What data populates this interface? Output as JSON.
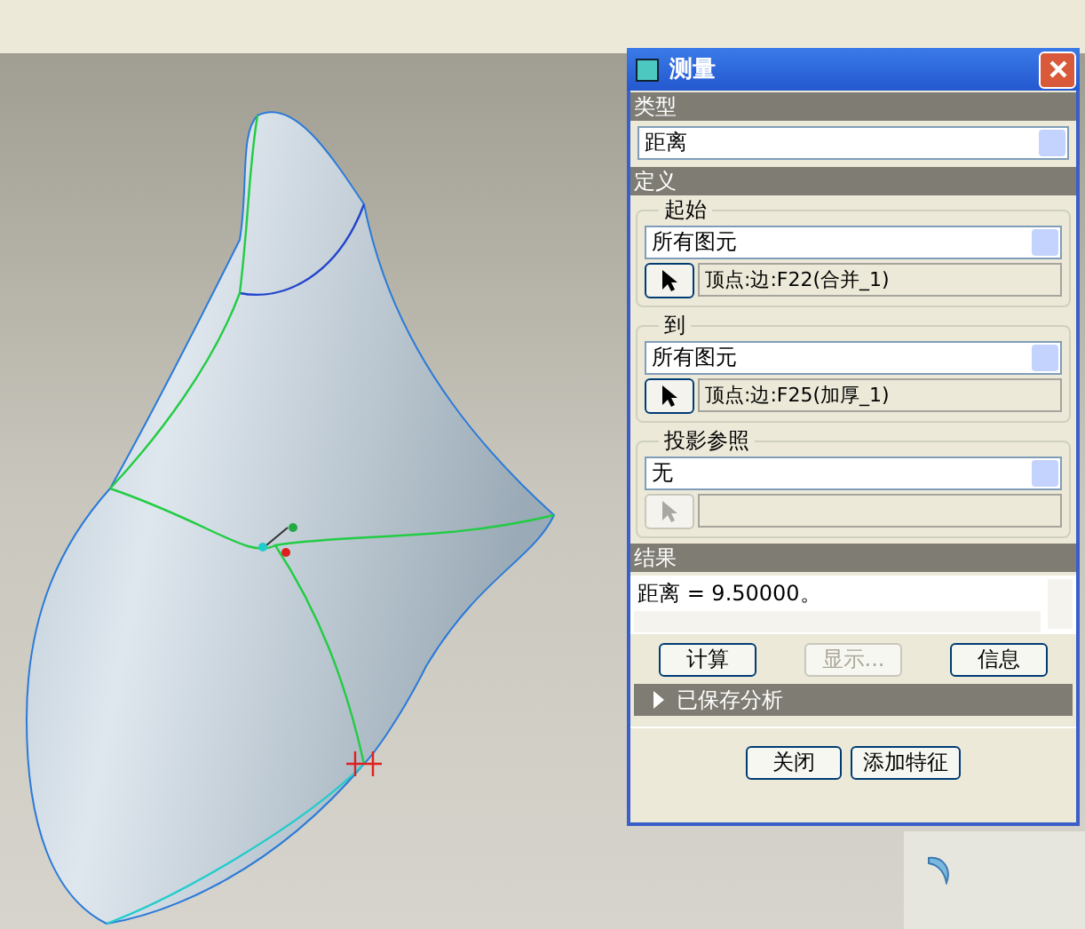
{
  "dialog": {
    "title": "测量",
    "type_section": {
      "label": "类型",
      "dropdown": "距离"
    },
    "definition_section": {
      "label": "定义",
      "groups": [
        {
          "label": "起始",
          "dropdown": "所有图元",
          "pick_value": "顶点:边:F22(合并_1)",
          "pick_disabled": false
        },
        {
          "label": "到",
          "dropdown": "所有图元",
          "pick_value": "顶点:边:F25(加厚_1)",
          "pick_disabled": false
        },
        {
          "label": "投影参照",
          "dropdown": "无",
          "pick_disabled": true
        }
      ]
    },
    "result_section": {
      "label": "结果",
      "text": "距离 = 9.50000。"
    },
    "result_buttons": [
      {
        "label": "计算",
        "disabled": false
      },
      {
        "label": "显示...",
        "disabled": true
      },
      {
        "label": "信息",
        "disabled": false
      }
    ],
    "saved_analysis": {
      "label": "已保存分析",
      "expanded": false
    },
    "footer_buttons": [
      {
        "label": "关闭"
      },
      {
        "label": "添加特征"
      }
    ]
  }
}
